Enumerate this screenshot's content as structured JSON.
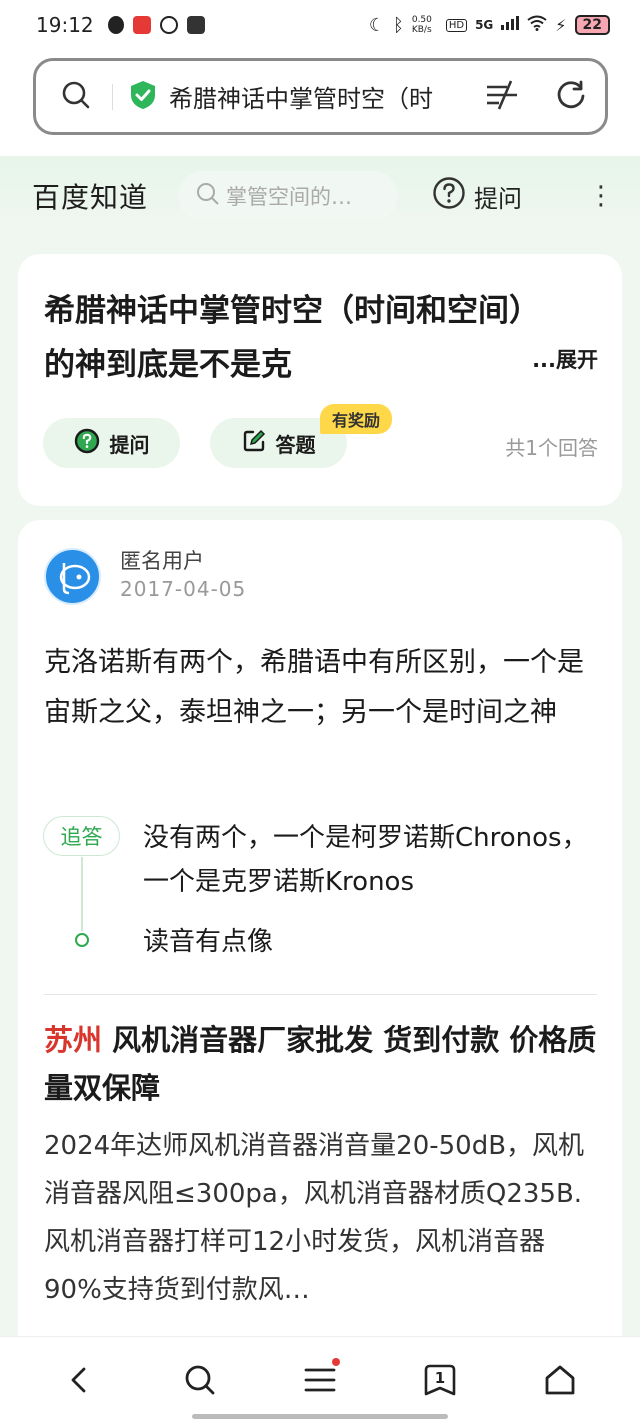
{
  "status_bar": {
    "time": "19:12",
    "net_speed": "0.50\nKB/s",
    "net_speed_display": "0.50 KB/s",
    "signal": "5G",
    "hd": "HD",
    "battery": "22"
  },
  "url_bar": {
    "url_text": "希腊神话中掌管时空（时"
  },
  "zhidao_header": {
    "logo": "百度知道",
    "search_placeholder": "掌管空间的…",
    "ask_label": "提问"
  },
  "question": {
    "title": "希腊神话中掌管时空（时间和空间）的神到底是不是克",
    "expand_label": "...展开",
    "ask_button": "提问",
    "answer_button": "答题",
    "reward_badge": "有奖励",
    "answer_count": "共1个回答"
  },
  "answer": {
    "user_name": "匿名用户",
    "date": "2017-04-05",
    "body": "克洛诺斯有两个，希腊语中有所区别，一个是宙斯之父，泰坦神之一；另一个是时间之神",
    "followup_tag": "追答",
    "followup_text": "没有两个，一个是柯罗诺斯Chronos，一个是克罗诺斯Kronos",
    "followup_text2": "读音有点像"
  },
  "ad": {
    "city": "苏州",
    "title": " 风机消音器厂家批发 货到付款 价格质量双保障",
    "description": "2024年达师风机消音器消音量20-50dB，风机消音器风阻≤300pa，风机消音器材质Q235B.风机消音器打样可12小时发货，风机消音器90%支持货到付款风…"
  },
  "bottom_nav": {
    "tabs_count": "1"
  },
  "colors": {
    "accent_green": "#2fa84f",
    "ad_city_red": "#d8362c",
    "page_bg": "#f0f7f1"
  }
}
